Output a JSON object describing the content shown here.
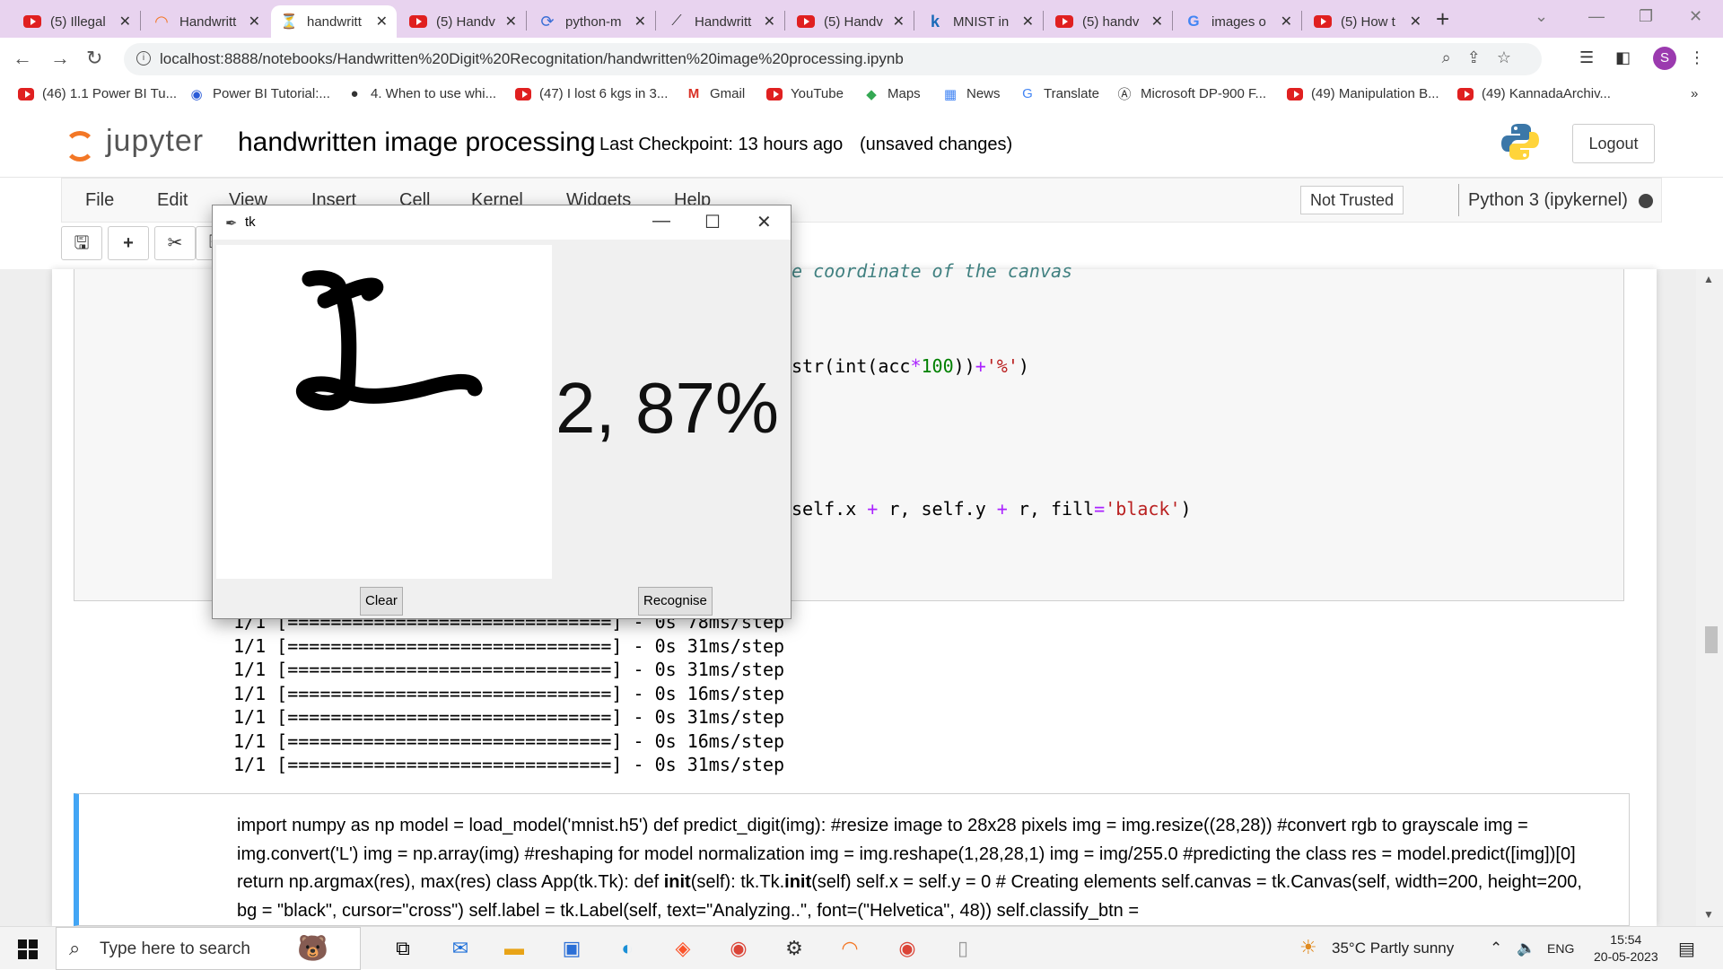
{
  "browser": {
    "tabs": [
      {
        "title": "(5) Illegal",
        "icon": "youtube-icon"
      },
      {
        "title": "Handwritt",
        "icon": "jupyter-icon"
      },
      {
        "title": "handwritt",
        "icon": "hourglass-icon"
      },
      {
        "title": "(5) Handv",
        "icon": "youtube-icon"
      },
      {
        "title": "python-m",
        "icon": "link-icon"
      },
      {
        "title": "Handwritt",
        "icon": "chart-icon"
      },
      {
        "title": "(5) Handv",
        "icon": "youtube-icon"
      },
      {
        "title": "MNIST in",
        "icon": "kaggle-icon"
      },
      {
        "title": "(5) handv",
        "icon": "youtube-icon"
      },
      {
        "title": "images o",
        "icon": "google-icon"
      },
      {
        "title": "(5) How t",
        "icon": "youtube-icon"
      }
    ],
    "url": "localhost:8888/notebooks/Handwritten%20Digit%20Recognitation/handwritten%20image%20processing.ipynb",
    "profile_initial": "S",
    "bookmarks": [
      {
        "label": "(46) 1.1 Power BI Tu...",
        "icon": "youtube-icon"
      },
      {
        "label": "Power BI Tutorial:...",
        "icon": "globe-icon"
      },
      {
        "label": "4. When to use whi...",
        "icon": "github-icon"
      },
      {
        "label": "(47) I lost 6 kgs in 3...",
        "icon": "youtube-icon"
      },
      {
        "label": "Gmail",
        "icon": "gmail-icon"
      },
      {
        "label": "YouTube",
        "icon": "youtube-icon"
      },
      {
        "label": "Maps",
        "icon": "maps-icon"
      },
      {
        "label": "News",
        "icon": "news-icon"
      },
      {
        "label": "Translate",
        "icon": "translate-icon"
      },
      {
        "label": "Microsoft DP-900 F...",
        "icon": "compass-icon"
      },
      {
        "label": "(49) Manipulation B...",
        "icon": "youtube-icon"
      },
      {
        "label": "(49) KannadaArchiv...",
        "icon": "youtube-icon"
      }
    ],
    "more": "»"
  },
  "jupyter": {
    "logo_text": "jupyter",
    "notebook_title": "handwritten image processing",
    "checkpoint": "Last Checkpoint: 13 hours ago",
    "unsaved": "(unsaved changes)",
    "logout": "Logout",
    "menu": [
      "File",
      "Edit",
      "View",
      "Insert",
      "Cell",
      "Kernel",
      "Widgets",
      "Help"
    ],
    "trust": "Not Trusted",
    "kernel": "Python 3 (ipykernel)"
  },
  "cell1": {
    "comment_fragment": "e coordinate of the canvas",
    "code_line_1": {
      "a": "str(int(acc",
      "op": "*",
      "n": "100",
      "b": "))",
      "plus": "+",
      "s": "'%'",
      "c": ")"
    },
    "code_line_2": {
      "a": "self.x ",
      "p1": "+",
      "b": " r, self.y ",
      "p2": "+",
      "c": " r, fill",
      "eq": "=",
      "s": "'black'",
      "d": ")"
    }
  },
  "output_lines": [
    "1/1 [==============================] - 0s 78ms/step",
    "1/1 [==============================] - 0s 31ms/step",
    "1/1 [==============================] - 0s 31ms/step",
    "1/1 [==============================] - 0s 16ms/step",
    "1/1 [==============================] - 0s 31ms/step",
    "1/1 [==============================] - 0s 16ms/step",
    "1/1 [==============================] - 0s 31ms/step"
  ],
  "markdown_cell": {
    "text_before": "import numpy as np model = load_model('mnist.h5') def predict_digit(img): #resize image to 28x28 pixels img = img.resize((28,28)) #convert rgb to grayscale img = img.convert('L') img = np.array(img) #reshaping for model normalization img = img.reshape(1,28,28,1) img = img/255.0 #predicting the class res = model.predict([img])[0] return np.argmax(res), max(res) class App(tk.Tk): def ",
    "bold_1": "init",
    "text_mid": "(self): tk.Tk.",
    "bold_2": "init",
    "text_after": "(self) self.x = self.y = 0 # Creating elements self.canvas = tk.Canvas(self, width=200, height=200, bg = \"black\", cursor=\"cross\") self.label = tk.Label(self, text=\"Analyzing..\", font=(\"Helvetica\", 48)) self.classify_btn ="
  },
  "tk_window": {
    "title": "tk",
    "prediction": "2, 87%",
    "clear_button": "Clear",
    "recognise_button": "Recognise",
    "stroke_color": "#000000"
  },
  "taskbar": {
    "search_placeholder": "Type here to search",
    "weather": "35°C  Partly sunny",
    "language": "ENG",
    "time": "15:54",
    "date": "20-05-2023"
  },
  "colors": {
    "tabstrip": "#e8d3ef",
    "jupyter_orange": "#f37726",
    "cell_accent": "#42a5f5",
    "profile": "#9b3aaf"
  }
}
